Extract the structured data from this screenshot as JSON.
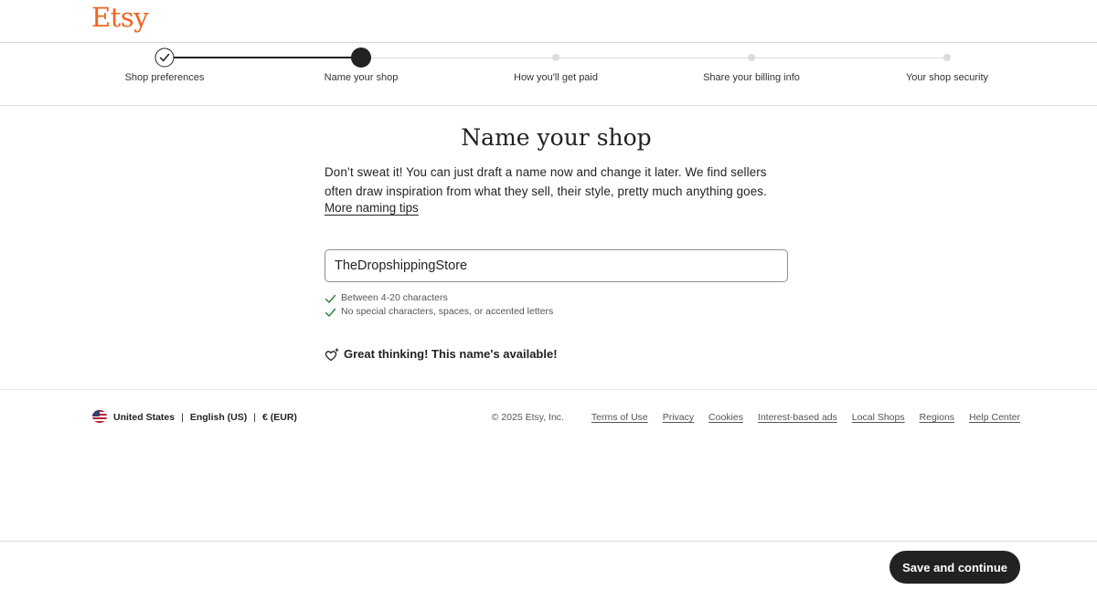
{
  "header": {
    "logo": "Etsy"
  },
  "steps": [
    {
      "label": "Shop preferences",
      "state": "done"
    },
    {
      "label": "Name your shop",
      "state": "current"
    },
    {
      "label": "How you'll get paid",
      "state": "pending"
    },
    {
      "label": "Share your billing info",
      "state": "pending"
    },
    {
      "label": "Your shop security",
      "state": "pending"
    }
  ],
  "main": {
    "title": "Name your shop",
    "description_line1": "Don’t sweat it! You can just draft a name now and change it later. We find sellers",
    "description_line2": "often draw inspiration from what they sell, their style, pretty much anything goes.",
    "tips_link": "More naming tips",
    "shop_name_value": "TheDropshippingStore",
    "requirements": [
      {
        "text": "Between 4-20 characters",
        "met": true
      },
      {
        "text": "No special characters, spaces, or accented letters",
        "met": true
      }
    ],
    "availability_message": "Great thinking! This name's available!"
  },
  "footer": {
    "region": "United States",
    "language": "English (US)",
    "currency": "€ (EUR)",
    "separator": "|",
    "copyright": "© 2025 Etsy, Inc.",
    "links": [
      "Terms of Use",
      "Privacy",
      "Cookies",
      "Interest-based ads",
      "Local Shops",
      "Regions",
      "Help Center"
    ]
  },
  "actions": {
    "save_label": "Save and continue"
  },
  "colors": {
    "brand": "#f1641e",
    "success": "#2e7d32",
    "primary_button": "#222222"
  }
}
